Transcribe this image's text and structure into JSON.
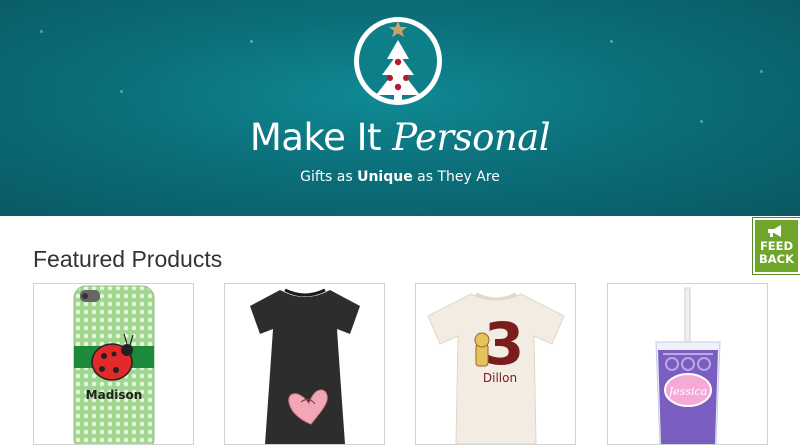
{
  "hero": {
    "title_part1": "Make It ",
    "title_part2": "Personal",
    "tagline_before": "Gifts as ",
    "tagline_bold": "Unique",
    "tagline_after": " as They Are",
    "background_color": "#0b6f7a"
  },
  "featured": {
    "heading": "Featured Products",
    "products": [
      {
        "icon": "ladybug-phone-case",
        "printed_name": "Madison"
      },
      {
        "icon": "maternity-tshirt"
      },
      {
        "icon": "kids-tshirt",
        "printed_number": "3",
        "printed_name": "Dillon"
      },
      {
        "icon": "acrylic-tumbler",
        "printed_name": "Jessica"
      }
    ]
  },
  "feedback_tab": {
    "line1": "FEED",
    "line2": "BACK",
    "color": "#6fa52a"
  }
}
